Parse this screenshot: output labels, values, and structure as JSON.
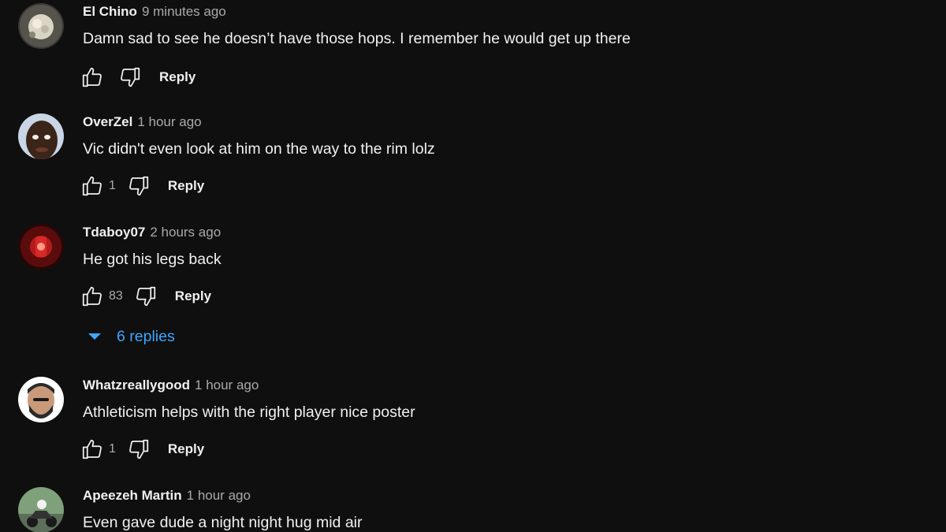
{
  "comments": [
    {
      "author": "El Chino",
      "time": "9 minutes ago",
      "text": "Damn sad to see he doesn’t have those hops. I remember he would get up there",
      "likes": "",
      "reply_label": "Reply"
    },
    {
      "author": "OverZel",
      "time": "1 hour ago",
      "text": "Vic didn't even look at him on the way to the rim lolz",
      "likes": "1",
      "reply_label": "Reply"
    },
    {
      "author": "Tdaboy07",
      "time": "2 hours ago",
      "text": "He got his legs back",
      "likes": "83",
      "reply_label": "Reply"
    },
    {
      "author": "Whatzreallygood",
      "time": "1 hour ago",
      "text": "Athleticism helps with the right player nice poster",
      "likes": "1",
      "reply_label": "Reply"
    },
    {
      "author": "Apeezeh Martin",
      "time": "1 hour ago",
      "text": "Even gave dude a night night hug mid air",
      "likes": "",
      "reply_label": ""
    }
  ],
  "replies_toggle": {
    "label": "6 replies",
    "icon": "caret-down-icon"
  },
  "icons": {
    "like": "thumbs-up-icon",
    "dislike": "thumbs-down-icon"
  },
  "colors": {
    "background": "#0f0f0f",
    "text": "#f1f1f1",
    "secondary_text": "#aaaaaa",
    "link_blue": "#3ea6ff"
  }
}
